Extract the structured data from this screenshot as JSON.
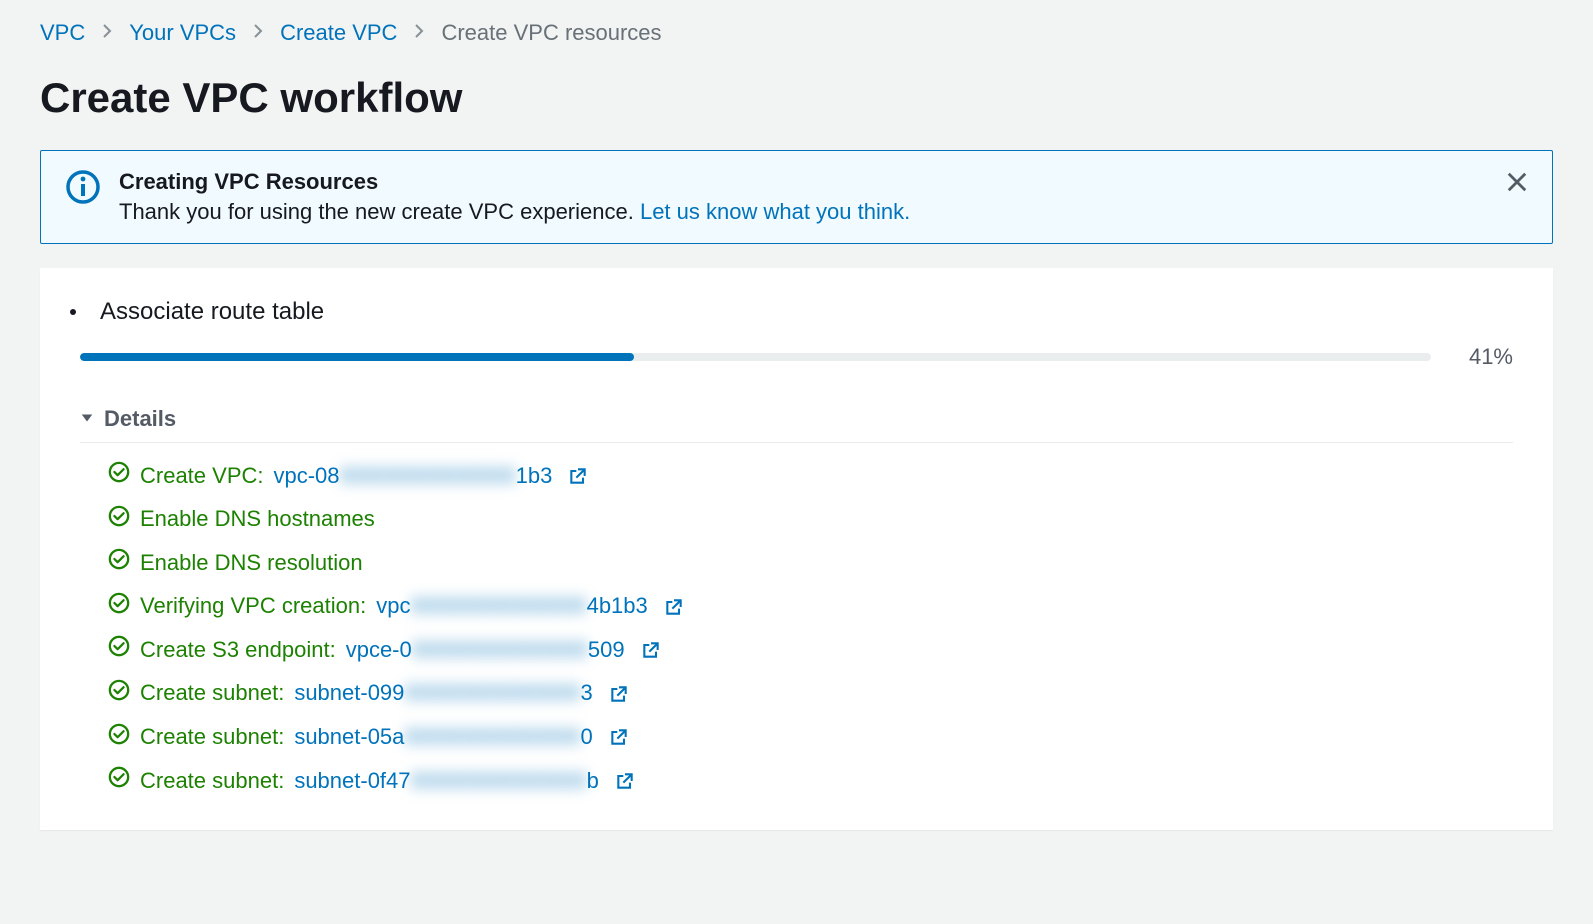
{
  "breadcrumb": {
    "items": [
      {
        "label": "VPC"
      },
      {
        "label": "Your VPCs"
      },
      {
        "label": "Create VPC"
      }
    ],
    "current": "Create VPC resources"
  },
  "page_title": "Create VPC workflow",
  "alert": {
    "title": "Creating VPC Resources",
    "text_prefix": "Thank you for using the new create VPC experience. ",
    "link_text": "Let us know what you think."
  },
  "progress": {
    "current_step_label": "Associate route table",
    "percent_value": 41,
    "percent_label": "41%"
  },
  "details": {
    "header": "Details",
    "steps": [
      {
        "text": "Create VPC: ",
        "link_prefix": "vpc-08",
        "link_blur": "XXXXXXXXXXXX",
        "link_suffix": "1b3",
        "has_external": true
      },
      {
        "text": "Enable DNS hostnames",
        "has_external": false
      },
      {
        "text": "Enable DNS resolution",
        "has_external": false
      },
      {
        "text": "Verifying VPC creation: ",
        "link_prefix": "vpc",
        "link_blur": "XXXXXXXXXXXX",
        "link_suffix": "4b1b3",
        "has_external": true
      },
      {
        "text": "Create S3 endpoint: ",
        "link_prefix": "vpce-0",
        "link_blur": "XXXXXXXXXXXX",
        "link_suffix": "509",
        "has_external": true
      },
      {
        "text": "Create subnet: ",
        "link_prefix": "subnet-099",
        "link_blur": "XXXXXXXXXXXX",
        "link_suffix": "3",
        "has_external": true
      },
      {
        "text": "Create subnet: ",
        "link_prefix": "subnet-05a",
        "link_blur": "XXXXXXXXXXXX",
        "link_suffix": "0",
        "has_external": true
      },
      {
        "text": "Create subnet: ",
        "link_prefix": "subnet-0f47",
        "link_blur": "XXXXXXXXXXXX",
        "link_suffix": "b",
        "has_external": true
      }
    ]
  },
  "colors": {
    "link": "#0073bb",
    "success": "#1d8102"
  }
}
